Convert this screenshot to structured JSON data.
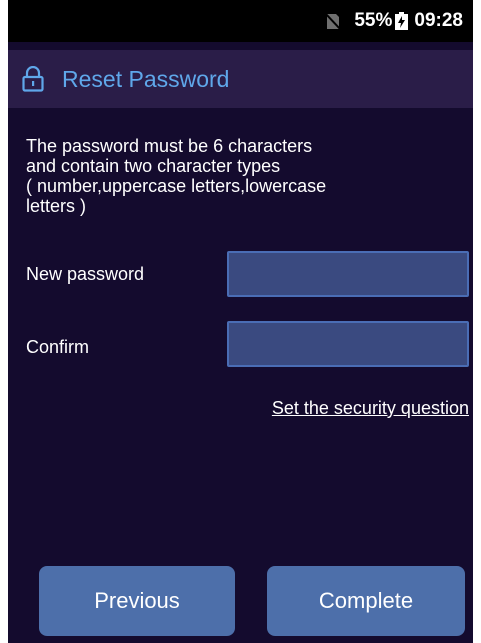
{
  "status_bar": {
    "sim_icon": "no-sim-icon",
    "battery_percent": "55%",
    "battery_icon": "battery-charging-icon",
    "time": "09:28"
  },
  "header": {
    "icon": "lock-icon",
    "title": "Reset Password"
  },
  "form": {
    "rules": "The password must be 6 characters\nand contain two character types\n( number,uppercase letters,lowercase\nletters )",
    "new_password": {
      "label": "New password",
      "value": "",
      "placeholder": ""
    },
    "confirm": {
      "label": "Confirm",
      "value": "",
      "placeholder": ""
    },
    "security_link": "Set the security question"
  },
  "actions": {
    "previous": "Previous",
    "complete": "Complete"
  },
  "colors": {
    "background": "#140b2e",
    "title_bar": "#2a1d48",
    "title_text": "#5fa7ea",
    "input_fill": "#3a4a80",
    "input_border": "#4a6db5",
    "button": "#4d6faa"
  }
}
